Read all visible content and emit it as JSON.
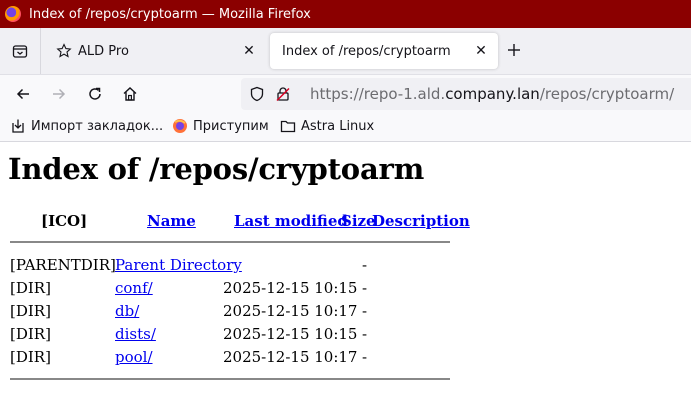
{
  "window": {
    "title": "Index of /repos/cryptoarm — Mozilla Firefox",
    "titlebar_color": "#8b0000"
  },
  "tabs": [
    {
      "label": "ALD Pro",
      "active": false
    },
    {
      "label": "Index of /repos/cryptoarm",
      "active": true
    }
  ],
  "urlbar": {
    "prefix": "https://repo-1.ald.",
    "host": "company.lan",
    "path": "/repos/cryptoarm/"
  },
  "bookmarks": [
    {
      "label": "Импорт закладок...",
      "icon": "import-icon"
    },
    {
      "label": "Приступим",
      "icon": "firefox-icon"
    },
    {
      "label": "Astra Linux",
      "icon": "folder-icon"
    }
  ],
  "page": {
    "heading": "Index of /repos/cryptoarm",
    "columns": {
      "ico": "[ICO]",
      "name": "Name",
      "modified": "Last modified",
      "size": "Size",
      "description": "Description"
    },
    "rows": [
      {
        "icon": "[PARENTDIR]",
        "name": "Parent Directory",
        "modified": "",
        "size": "-"
      },
      {
        "icon": "[DIR]",
        "name": "conf/",
        "modified": "2025-12-15 10:15",
        "size": "-"
      },
      {
        "icon": "[DIR]",
        "name": "db/",
        "modified": "2025-12-15 10:17",
        "size": "-"
      },
      {
        "icon": "[DIR]",
        "name": "dists/",
        "modified": "2025-12-15 10:15",
        "size": "-"
      },
      {
        "icon": "[DIR]",
        "name": "pool/",
        "modified": "2025-12-15 10:17",
        "size": "-"
      }
    ]
  }
}
